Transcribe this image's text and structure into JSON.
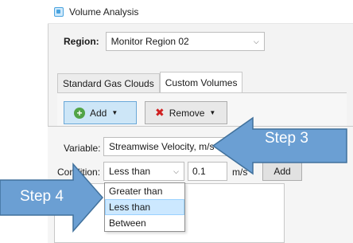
{
  "window": {
    "title": "Volume Analysis"
  },
  "region": {
    "label": "Region:",
    "value": "Monitor Region 02"
  },
  "tabs": [
    {
      "label": "Standard Gas Clouds"
    },
    {
      "label": "Custom Volumes"
    }
  ],
  "toolbar": {
    "add_label": "Add",
    "remove_label": "Remove"
  },
  "form": {
    "variable_label": "Variable:",
    "variable_value": "Streamwise Velocity, m/s",
    "condition_label": "Condition:",
    "condition_value": "Less than",
    "threshold_value": "0.1",
    "unit": "m/s",
    "add_label": "Add"
  },
  "dropdown": {
    "options": [
      "Greater than",
      "Less than",
      "Between"
    ],
    "selected": "Less than"
  },
  "callouts": {
    "step3": "Step 3",
    "step4": "Step 4"
  },
  "colors": {
    "callout": "#6b9fd3",
    "accent": "#cde6f7"
  }
}
